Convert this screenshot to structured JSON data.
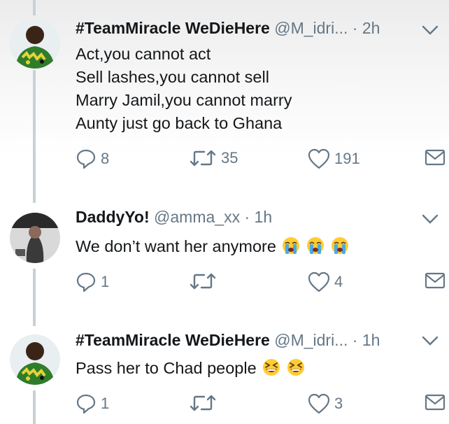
{
  "colors": {
    "text": "#14171a",
    "muted": "#657786",
    "thread_line": "#c9d0d6"
  },
  "tweets": [
    {
      "name": "#TeamMiracle WeDieHere",
      "handle": "@M_idri...",
      "dot": "·",
      "time": "2h",
      "lines": [
        "Act,you cannot act",
        "Sell lashes,you cannot sell",
        "Marry Jamil,you cannot marry",
        "Aunty just go back to Ghana"
      ],
      "emojis": [],
      "replies": "8",
      "retweets": "35",
      "likes": "191",
      "icons": [
        "reply-icon",
        "retweet-icon",
        "like-icon",
        "message-icon"
      ]
    },
    {
      "name": "DaddyYo!",
      "handle": "@amma_xx",
      "dot": "·",
      "time": "1h",
      "lines": [
        "We don’t want her anymore"
      ],
      "emojis": [
        "loudly-crying-face",
        "loudly-crying-face",
        "loudly-crying-face"
      ],
      "replies": "1",
      "retweets": "",
      "likes": "4",
      "icons": [
        "reply-icon",
        "retweet-icon",
        "like-icon",
        "message-icon"
      ]
    },
    {
      "name": "#TeamMiracle WeDieHere",
      "handle": "@M_idri...",
      "dot": "·",
      "time": "1h",
      "lines": [
        "Pass her to Chad people"
      ],
      "emojis": [
        "grinning-squinting-face",
        "grinning-squinting-face"
      ],
      "replies": "1",
      "retweets": "",
      "likes": "3",
      "icons": [
        "reply-icon",
        "retweet-icon",
        "like-icon",
        "message-icon"
      ]
    }
  ]
}
